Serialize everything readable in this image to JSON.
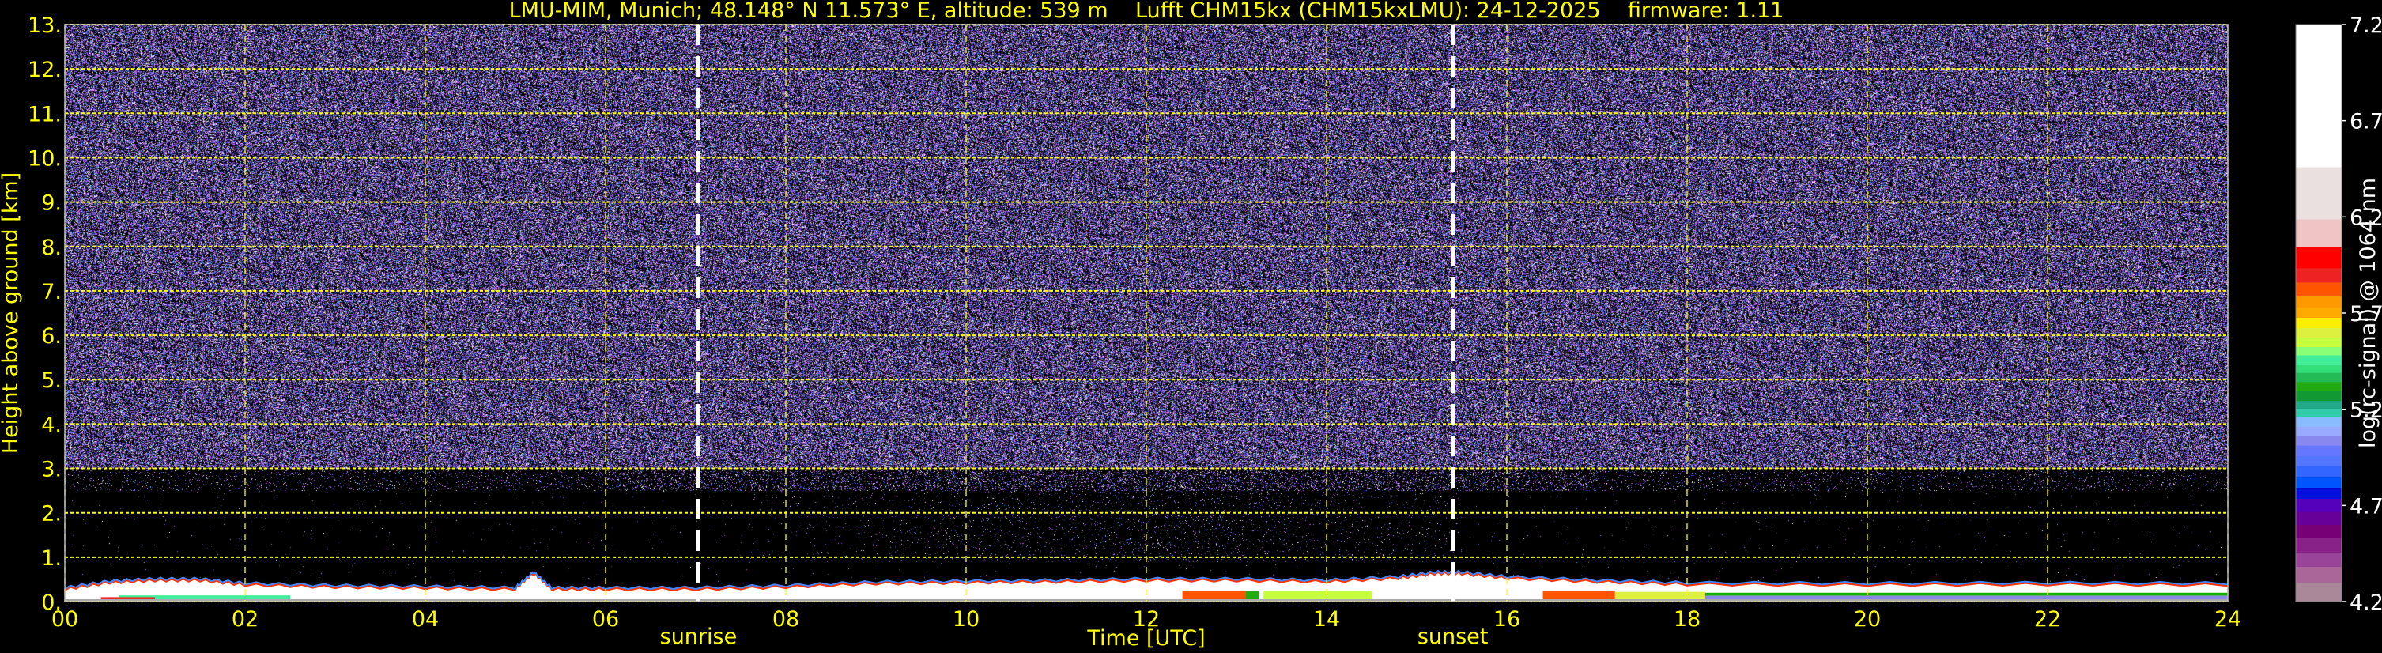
{
  "title": "LMU-MIM, Munich; 48.148° N 11.573° E, altitude: 539 m    Lufft CHM15kx (CHM15kxLMU): 24-12-2025    firmware: 1.11",
  "chart_data": {
    "type": "heatmap",
    "title": "LMU-MIM, Munich; 48.148° N 11.573° E, altitude: 539 m    Lufft CHM15kx (CHM15kxLMU): 24-12-2025    firmware: 1.11",
    "xlabel": "Time [UTC]",
    "ylabel": "Height above ground [km]",
    "xlim": [
      0,
      24
    ],
    "ylim": [
      0,
      13
    ],
    "xticks": [
      "00",
      "02",
      "04",
      "06",
      "08",
      "10",
      "12",
      "14",
      "16",
      "18",
      "20",
      "22",
      "24"
    ],
    "yticks": [
      "0.",
      "1.",
      "2.",
      "3.",
      "4.",
      "5.",
      "6.",
      "7.",
      "8.",
      "9.",
      "10.",
      "11.",
      "12.",
      "13."
    ],
    "grid": true,
    "markers": [
      {
        "label": "sunrise",
        "time": 7.03
      },
      {
        "label": "sunset",
        "time": 15.4
      }
    ],
    "colorbar": {
      "label": "log(rc-signal) @ 1064 nm",
      "range": [
        4.2,
        7.2
      ],
      "ticks": [
        "7.2",
        "6.7",
        "6.2",
        "5.7",
        "5.2",
        "4.7",
        "4.2"
      ],
      "levels": [
        [
          6.458,
          "#ffffff"
        ],
        [
          6.187,
          "#ebe0e0"
        ],
        [
          6.042,
          "#f0c4c4"
        ],
        [
          5.933,
          "#ff0000"
        ],
        [
          5.859,
          "#ee2222"
        ],
        [
          5.786,
          "#ff5500"
        ],
        [
          5.729,
          "#ff9900"
        ],
        [
          5.675,
          "#ffaa00"
        ],
        [
          5.621,
          "#ffee00"
        ],
        [
          5.573,
          "#ddf040"
        ],
        [
          5.523,
          "#c4ff40"
        ],
        [
          5.48,
          "#88ff77"
        ],
        [
          5.428,
          "#44ee99"
        ],
        [
          5.389,
          "#33dd77"
        ],
        [
          5.341,
          "#22bb55"
        ],
        [
          5.295,
          "#22aa11"
        ],
        [
          5.243,
          "#119933"
        ],
        [
          5.202,
          "#22aa88"
        ],
        [
          5.161,
          "#33ccaa"
        ],
        [
          5.109,
          "#88bbff"
        ],
        [
          5.059,
          "#99aaff"
        ],
        [
          5.011,
          "#8888ee"
        ],
        [
          4.957,
          "#6677ff"
        ],
        [
          4.905,
          "#5577ff"
        ],
        [
          4.846,
          "#3366ff"
        ],
        [
          4.792,
          "#0055ff"
        ],
        [
          4.734,
          "#0011dd"
        ],
        [
          4.666,
          "#5500bb"
        ],
        [
          4.599,
          "#660099"
        ],
        [
          4.532,
          "#770077"
        ],
        [
          4.454,
          "#882288"
        ],
        [
          4.38,
          "#994499"
        ],
        [
          4.298,
          "#aa6699"
        ],
        [
          4.2,
          "#aa8899"
        ]
      ]
    },
    "aerosol_layer_top_km": {
      "time": [
        0,
        0.5,
        1,
        1.5,
        2,
        3,
        4,
        5,
        5.2,
        5.4,
        6,
        7,
        8,
        9,
        10,
        11,
        12,
        13,
        14,
        14.8,
        15.2,
        15.5,
        16,
        17,
        18,
        20,
        22,
        24
      ],
      "height": [
        0.25,
        0.4,
        0.45,
        0.45,
        0.35,
        0.3,
        0.28,
        0.25,
        0.6,
        0.25,
        0.25,
        0.25,
        0.3,
        0.38,
        0.4,
        0.42,
        0.45,
        0.45,
        0.42,
        0.5,
        0.6,
        0.6,
        0.5,
        0.42,
        0.36,
        0.35,
        0.36,
        0.35
      ]
    },
    "signal_features": [
      {
        "t0": 0.6,
        "t1": 2.5,
        "h0": 0.03,
        "h1": 0.14,
        "value": 5.45
      },
      {
        "t0": 0.4,
        "t1": 1.0,
        "h0": 0.03,
        "h1": 0.1,
        "value": 5.9
      },
      {
        "t0": 12.4,
        "t1": 13.1,
        "h0": 0.05,
        "h1": 0.25,
        "value": 5.8
      },
      {
        "t0": 13.1,
        "t1": 13.25,
        "h0": 0.05,
        "h1": 0.25,
        "value": 5.3
      },
      {
        "t0": 13.3,
        "t1": 14.5,
        "h0": 0.05,
        "h1": 0.25,
        "value": 5.55
      },
      {
        "t0": 16.4,
        "t1": 17.2,
        "h0": 0.05,
        "h1": 0.25,
        "value": 5.85
      },
      {
        "t0": 17.2,
        "t1": 18.2,
        "h0": 0.05,
        "h1": 0.22,
        "value": 5.6
      },
      {
        "t0": 18.2,
        "t1": 24,
        "h0": 0.13,
        "h1": 0.2,
        "value": 5.3
      },
      {
        "t0": 18.2,
        "t1": 24,
        "h0": 0.05,
        "h1": 0.13,
        "value": 5.05
      }
    ]
  }
}
